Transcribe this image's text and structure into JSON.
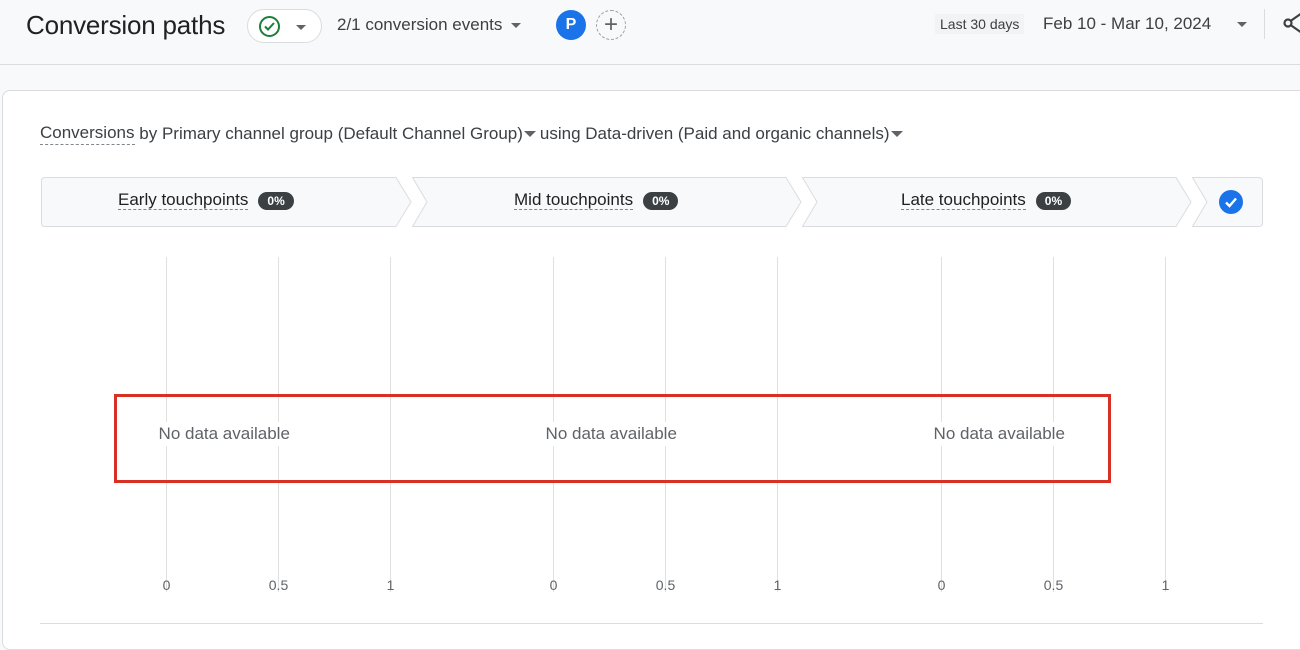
{
  "header": {
    "title": "Conversion paths",
    "status_icon": "check-circle-icon",
    "events_label": "2/1 conversion events",
    "avatar_letter": "P",
    "add_comparison_icon": "plus-icon",
    "date_preset": "Last 30 days",
    "date_range": "Feb 10 - Mar 10, 2024",
    "share_icon": "share-icon"
  },
  "selector": {
    "metric": "Conversions",
    "by": "by",
    "dimension": "Primary channel group (Default Channel Group)",
    "using": "using",
    "model": "Data-driven (Paid and organic channels)"
  },
  "steps": [
    {
      "label": "Early touchpoints",
      "percent": "0%"
    },
    {
      "label": "Mid touchpoints",
      "percent": "0%"
    },
    {
      "label": "Late touchpoints",
      "percent": "0%"
    }
  ],
  "chart_data": {
    "type": "bar",
    "panels": [
      {
        "title": "Early touchpoints",
        "message": "No data available",
        "xticks": [
          "0",
          "0.5",
          "1"
        ],
        "xlim": [
          0,
          1
        ],
        "values": []
      },
      {
        "title": "Mid touchpoints",
        "message": "No data available",
        "xticks": [
          "0",
          "0.5",
          "1"
        ],
        "xlim": [
          0,
          1
        ],
        "values": []
      },
      {
        "title": "Late touchpoints",
        "message": "No data available",
        "xticks": [
          "0",
          "0.5",
          "1"
        ],
        "xlim": [
          0,
          1
        ],
        "values": []
      }
    ],
    "grid": true
  },
  "colors": {
    "accent": "#1a73e8",
    "success": "#188038",
    "highlight": "#d93025"
  }
}
